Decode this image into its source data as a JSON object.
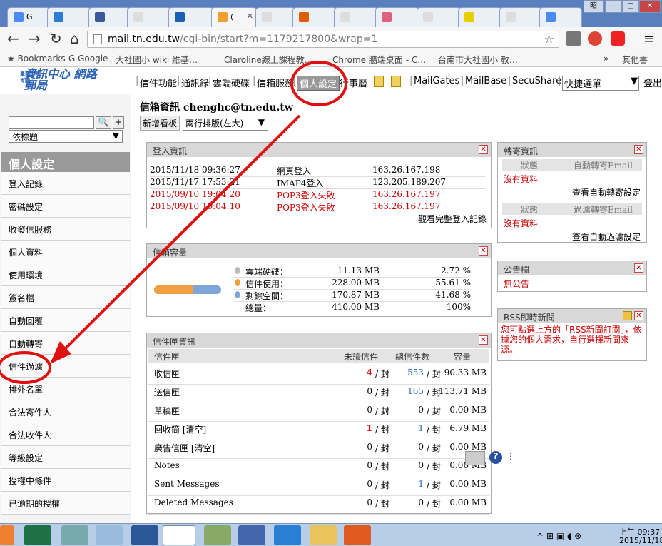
{
  "browser": {
    "tabs": [
      {
        "label": "G",
        "fav": "#4a8af4"
      },
      {
        "label": "",
        "fav": "#2d7cd6"
      },
      {
        "label": "",
        "fav": "#3b5998"
      },
      {
        "label": "",
        "fav": "#ddd"
      },
      {
        "label": "",
        "fav": "#1a5fb4"
      },
      {
        "label": "(",
        "fav": "#f0a030"
      },
      {
        "label": "",
        "fav": "#ddd"
      },
      {
        "label": "",
        "fav": "#e05a00"
      },
      {
        "label": "",
        "fav": "#ddd"
      },
      {
        "label": "",
        "fav": "#e06080"
      },
      {
        "label": "",
        "fav": "#ddd"
      },
      {
        "label": "",
        "fav": "#e8d000"
      },
      {
        "label": "",
        "fav": "#ddd"
      },
      {
        "label": "",
        "fav": "#4a8af4"
      }
    ],
    "window_buttons": [
      "昭",
      "—",
      "□",
      "✕"
    ],
    "url_host": "mail.tn.edu.tw",
    "url_path": "/cgi-bin/start?m=1179217800&wrap=1",
    "bookmarks": [
      "Bookmarks",
      "Google",
      "大社國小 wiki 維基…",
      "Claroline線上課程教…",
      "Chrome 牆端桌面 - C…",
      "台南市大社國小 教…",
      "»",
      "其他書"
    ]
  },
  "app": {
    "logo_small": "臺南市教育網",
    "logo_title": "資訊中心 網路郵局",
    "user": "chenghc",
    "search_placeholder": "",
    "sort_option": "依標題",
    "nav": [
      "信件功能",
      "通訊錄",
      "雲端硬碟",
      "信箱服務",
      "個人設定",
      "行事曆",
      "MailGates",
      "MailBase",
      "SecuShare",
      "快捷選單",
      "登出"
    ],
    "side_title": "個人設定",
    "side_items": [
      "登入記錄",
      "密碼設定",
      "收發信服務",
      "個人資料",
      "使用環境",
      "簽名檔",
      "自動回覆",
      "自動轉寄",
      "信件過濾",
      "排外名單",
      "合法寄件人",
      "合法收件人",
      "等級設定",
      "授權中條件",
      "已逾期的授權"
    ],
    "main_title_prefix": "信箱資訊",
    "main_title_email": "chenghc@tn.edu.tw",
    "new_board_label": "新增看板",
    "layout_select": "兩行排版(左大)",
    "login_panel": {
      "title": "登入資訊",
      "rows": [
        {
          "time": "2015/11/18 09:36:27",
          "type": "網頁登入",
          "ip": "163.26.167.198",
          "fail": false
        },
        {
          "time": "2015/11/17 17:53:21",
          "type": "IMAP4登入",
          "ip": "123.205.189.207",
          "fail": false
        },
        {
          "time": "2015/09/10 19:04:20",
          "type": "POP3登入失敗",
          "ip": "163.26.167.197",
          "fail": true
        },
        {
          "time": "2015/09/10 19:04:10",
          "type": "POP3登入失敗",
          "ip": "163.26.167.197",
          "fail": true
        }
      ],
      "link": "觀看完整登入記錄"
    },
    "quota_panel": {
      "title": "信箱容量",
      "rows": [
        {
          "label": "雲端硬碟：",
          "size": "11.13 MB",
          "pct": "2.72 %",
          "dot": "#bbb"
        },
        {
          "label": "信件使用：",
          "size": "228.00 MB",
          "pct": "55.61 %",
          "dot": "#f0a040"
        },
        {
          "label": "剩餘空間：",
          "size": "170.87 MB",
          "pct": "41.68 %",
          "dot": "#7fa4d8"
        },
        {
          "label": "總量：",
          "size": "410.00 MB",
          "pct": "100%",
          "dot": ""
        }
      ],
      "bar_used_fraction": 0.5833
    },
    "forward_panel": {
      "title": "轉寄資訊",
      "h_status": "狀態",
      "h_auto": "自動轉寄Email",
      "none": "沒有資料",
      "link1": "查看自動轉寄設定",
      "h_status2": "狀態",
      "h_filter": "過濾轉寄Email",
      "none2": "沒有資料",
      "link2": "查看自動過濾設定"
    },
    "announce_panel": {
      "title": "公告欄",
      "text": "無公告"
    },
    "rss_panel": {
      "title": "RSS即時新聞",
      "text": "您可點選上方的「RSS新聞訂閱」，依據您的個人需求，自行選擇新聞來源。"
    },
    "folder_panel": {
      "title": "信件匣資訊",
      "headers": [
        "信件匣",
        "未讀信件",
        "總信件數",
        "容量"
      ],
      "unit": "封",
      "rows": [
        {
          "name": "收信匣",
          "unread": "4",
          "total": "553",
          "size": "90.33 MB",
          "ur": true,
          "tb": true
        },
        {
          "name": "送信匣",
          "unread": "0",
          "total": "165",
          "size": "113.71 MB",
          "ur": false,
          "tb": true
        },
        {
          "name": "草稿匣",
          "unread": "0",
          "total": "0",
          "size": "0.00 MB",
          "ur": false,
          "tb": false
        },
        {
          "name": "回收筒 [清空]",
          "unread": "1",
          "total": "1",
          "size": "6.79 MB",
          "ur": true,
          "tb": true
        },
        {
          "name": "廣告信匣 [清空]",
          "unread": "0",
          "total": "0",
          "size": "0.00 MB",
          "ur": false,
          "tb": false
        },
        {
          "name": "Notes",
          "unread": "0",
          "total": "0",
          "size": "0.00 MB",
          "ur": false,
          "tb": false
        },
        {
          "name": "Sent Messages",
          "unread": "0",
          "total": "1",
          "size": "0.00 MB",
          "ur": false,
          "tb": true
        },
        {
          "name": "Deleted Messages",
          "unread": "0",
          "total": "0",
          "size": "0.00 MB",
          "ur": false,
          "tb": false
        }
      ]
    }
  },
  "taskbar": {
    "clock_time": "上午 09:37",
    "clock_date": "2015/11/18",
    "show_hidden": "^"
  }
}
